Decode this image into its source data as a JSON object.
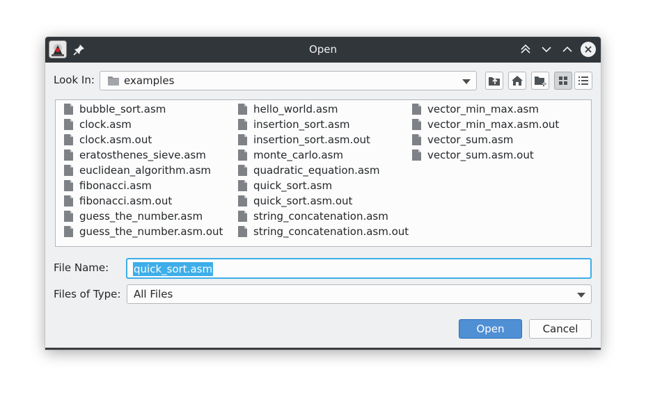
{
  "dialog": {
    "title": "Open",
    "app_icon": "java-duke-icon",
    "titlebar_icons": [
      "pin-icon",
      "keep-above-icon",
      "minimize-icon",
      "maximize-icon",
      "close-icon"
    ]
  },
  "look_in": {
    "label": "Look In:",
    "value": "examples",
    "icon": "folder-icon"
  },
  "toolbar": {
    "buttons": [
      "up-one-level-icon",
      "home-icon",
      "new-folder-icon",
      "list-view-icon",
      "details-view-icon"
    ],
    "active": "list-view-icon"
  },
  "files": {
    "columns": [
      [
        "bubble_sort.asm",
        "clock.asm",
        "clock.asm.out",
        "eratosthenes_sieve.asm",
        "euclidean_algorithm.asm",
        "fibonacci.asm",
        "fibonacci.asm.out",
        "guess_the_number.asm",
        "guess_the_number.asm.out"
      ],
      [
        "hello_world.asm",
        "insertion_sort.asm",
        "insertion_sort.asm.out",
        "monte_carlo.asm",
        "quadratic_equation.asm",
        "quick_sort.asm",
        "quick_sort.asm.out",
        "string_concatenation.asm",
        "string_concatenation.asm.out"
      ],
      [
        "vector_min_max.asm",
        "vector_min_max.asm.out",
        "vector_sum.asm",
        "vector_sum.asm.out"
      ]
    ]
  },
  "file_name": {
    "label": "File Name:",
    "value": "quick_sort.asm"
  },
  "file_type": {
    "label": "Files of Type:",
    "value": "All Files"
  },
  "buttons": {
    "open": "Open",
    "cancel": "Cancel"
  },
  "colors": {
    "titlebar": "#31363b",
    "accent": "#3daee9",
    "primary_button": "#4f8fd4",
    "window_bg": "#eff0f1"
  }
}
